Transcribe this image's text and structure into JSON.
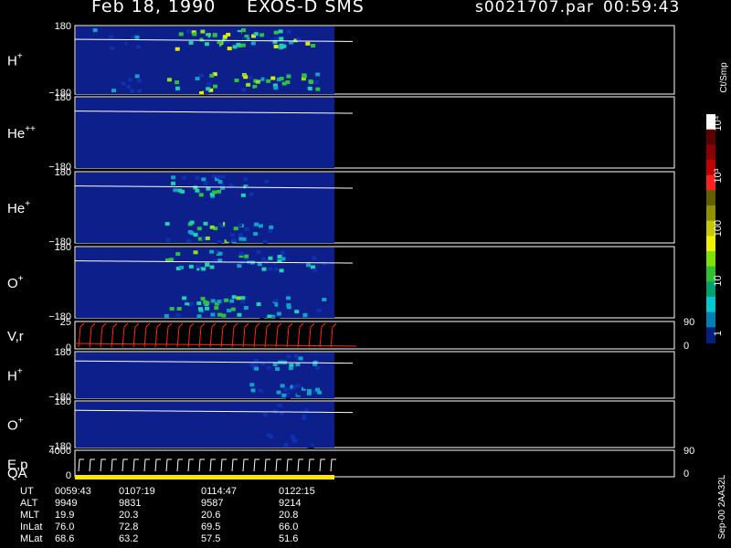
{
  "header": {
    "date": "Feb 18, 1990",
    "instrument": "EXOS-D SMS",
    "file": "s0021707.par",
    "time": "00:59:43"
  },
  "colors": {
    "background": "#0d1f8a",
    "trace": "#ffffff",
    "velocity_trace": "#ff2a00",
    "qa_bar": "#ffe600"
  },
  "colorbar": {
    "unit": "Ct/Smp",
    "ticks": [
      "10⁴",
      "10³",
      "100",
      "10",
      "1"
    ],
    "scale": "log"
  },
  "footer": {
    "rows": [
      {
        "label": "UT",
        "values": [
          "0059:43",
          "0107:19",
          "0114:47",
          "0122:15"
        ]
      },
      {
        "label": "ALT",
        "values": [
          "9949",
          "9831",
          "9587",
          "9214"
        ]
      },
      {
        "label": "MLT",
        "values": [
          "19.9",
          "20.3",
          "20.6",
          "20.8"
        ]
      },
      {
        "label": "InLat",
        "values": [
          "76.0",
          "72.8",
          "69.5",
          "66.0"
        ]
      },
      {
        "label": "MLat",
        "values": [
          "68.6",
          "63.2",
          "57.5",
          "51.6"
        ]
      }
    ],
    "side_label": "Sep-00  2AA32L"
  },
  "chart_data": {
    "type": "heatmap",
    "panels": [
      {
        "species": "H",
        "charge": "+",
        "ymax": "180",
        "ymin": "−180"
      },
      {
        "species": "He",
        "charge": "++",
        "ymax": "180",
        "ymin": "−180"
      },
      {
        "species": "He",
        "charge": "+",
        "ymax": "180",
        "ymin": "−180"
      },
      {
        "species": "O",
        "charge": "+",
        "ymax": "180",
        "ymin": "−180"
      },
      {
        "species": "V,r",
        "charge": "",
        "ymax": "25",
        "ymin": "0",
        "right_top": "90",
        "right_bottom": "0"
      },
      {
        "species": "H",
        "charge": "+",
        "ymax": "180",
        "ymin": "−180"
      },
      {
        "species": "O",
        "charge": "+",
        "ymax": "180",
        "ymin": "−180"
      },
      {
        "species": "E,p",
        "charge": "",
        "ymax": "4000",
        "ymin": "0",
        "right_top": "90",
        "right_bottom": "0"
      }
    ],
    "qa_label": "QA",
    "activity": [
      {
        "panel": 0,
        "intensity": [
          [
            0.15,
            0.35,
            0.3
          ],
          [
            0.45,
            0.95,
            0.9
          ],
          [
            0.6,
            0.95,
            0.85
          ],
          [
            0.72,
            0.9,
            0.6
          ],
          [
            0.85,
            0.98,
            0.9
          ]
        ]
      },
      {
        "panel": 2,
        "intensity": [
          [
            0.45,
            0.7,
            0.6
          ],
          [
            0.55,
            0.8,
            0.7
          ],
          [
            0.65,
            0.6,
            0.4
          ]
        ]
      },
      {
        "panel": 3,
        "intensity": [
          [
            0.45,
            0.75,
            0.6
          ],
          [
            0.55,
            0.85,
            0.7
          ],
          [
            0.7,
            0.7,
            0.5
          ],
          [
            0.85,
            0.6,
            0.4
          ]
        ]
      },
      {
        "panel": 5,
        "intensity": [
          [
            0.75,
            0.4,
            0.3
          ],
          [
            0.85,
            0.5,
            0.4
          ]
        ]
      },
      {
        "panel": 6,
        "intensity": [
          [
            0.8,
            0.3,
            0.2
          ]
        ]
      }
    ]
  }
}
